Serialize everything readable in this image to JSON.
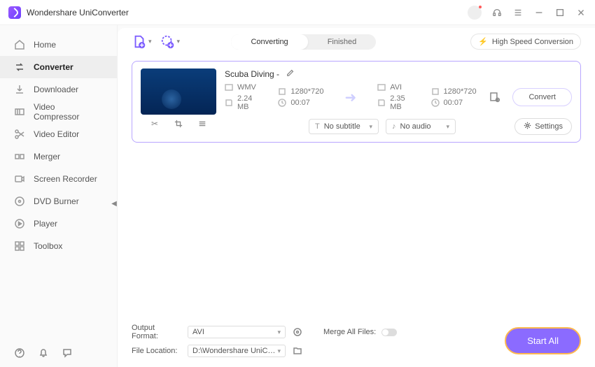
{
  "app": {
    "title": "Wondershare UniConverter"
  },
  "sidebar": {
    "items": [
      {
        "label": "Home"
      },
      {
        "label": "Converter"
      },
      {
        "label": "Downloader"
      },
      {
        "label": "Video Compressor"
      },
      {
        "label": "Video Editor"
      },
      {
        "label": "Merger"
      },
      {
        "label": "Screen Recorder"
      },
      {
        "label": "DVD Burner"
      },
      {
        "label": "Player"
      },
      {
        "label": "Toolbox"
      }
    ]
  },
  "tabs": {
    "converting": "Converting",
    "finished": "Finished"
  },
  "toolbar": {
    "high_speed": "High Speed Conversion"
  },
  "file": {
    "title": "Scuba Diving -",
    "src": {
      "format": "WMV",
      "resolution": "1280*720",
      "size": "2.24 MB",
      "duration": "00:07"
    },
    "dst": {
      "format": "AVI",
      "resolution": "1280*720",
      "size": "2.35 MB",
      "duration": "00:07"
    },
    "subtitle": "No subtitle",
    "audio": "No audio",
    "settings_label": "Settings",
    "convert_label": "Convert"
  },
  "bottom": {
    "output_format_label": "Output Format:",
    "output_format_value": "AVI",
    "file_location_label": "File Location:",
    "file_location_value": "D:\\Wondershare UniConverter",
    "merge_label": "Merge All Files:",
    "start_all": "Start All"
  }
}
